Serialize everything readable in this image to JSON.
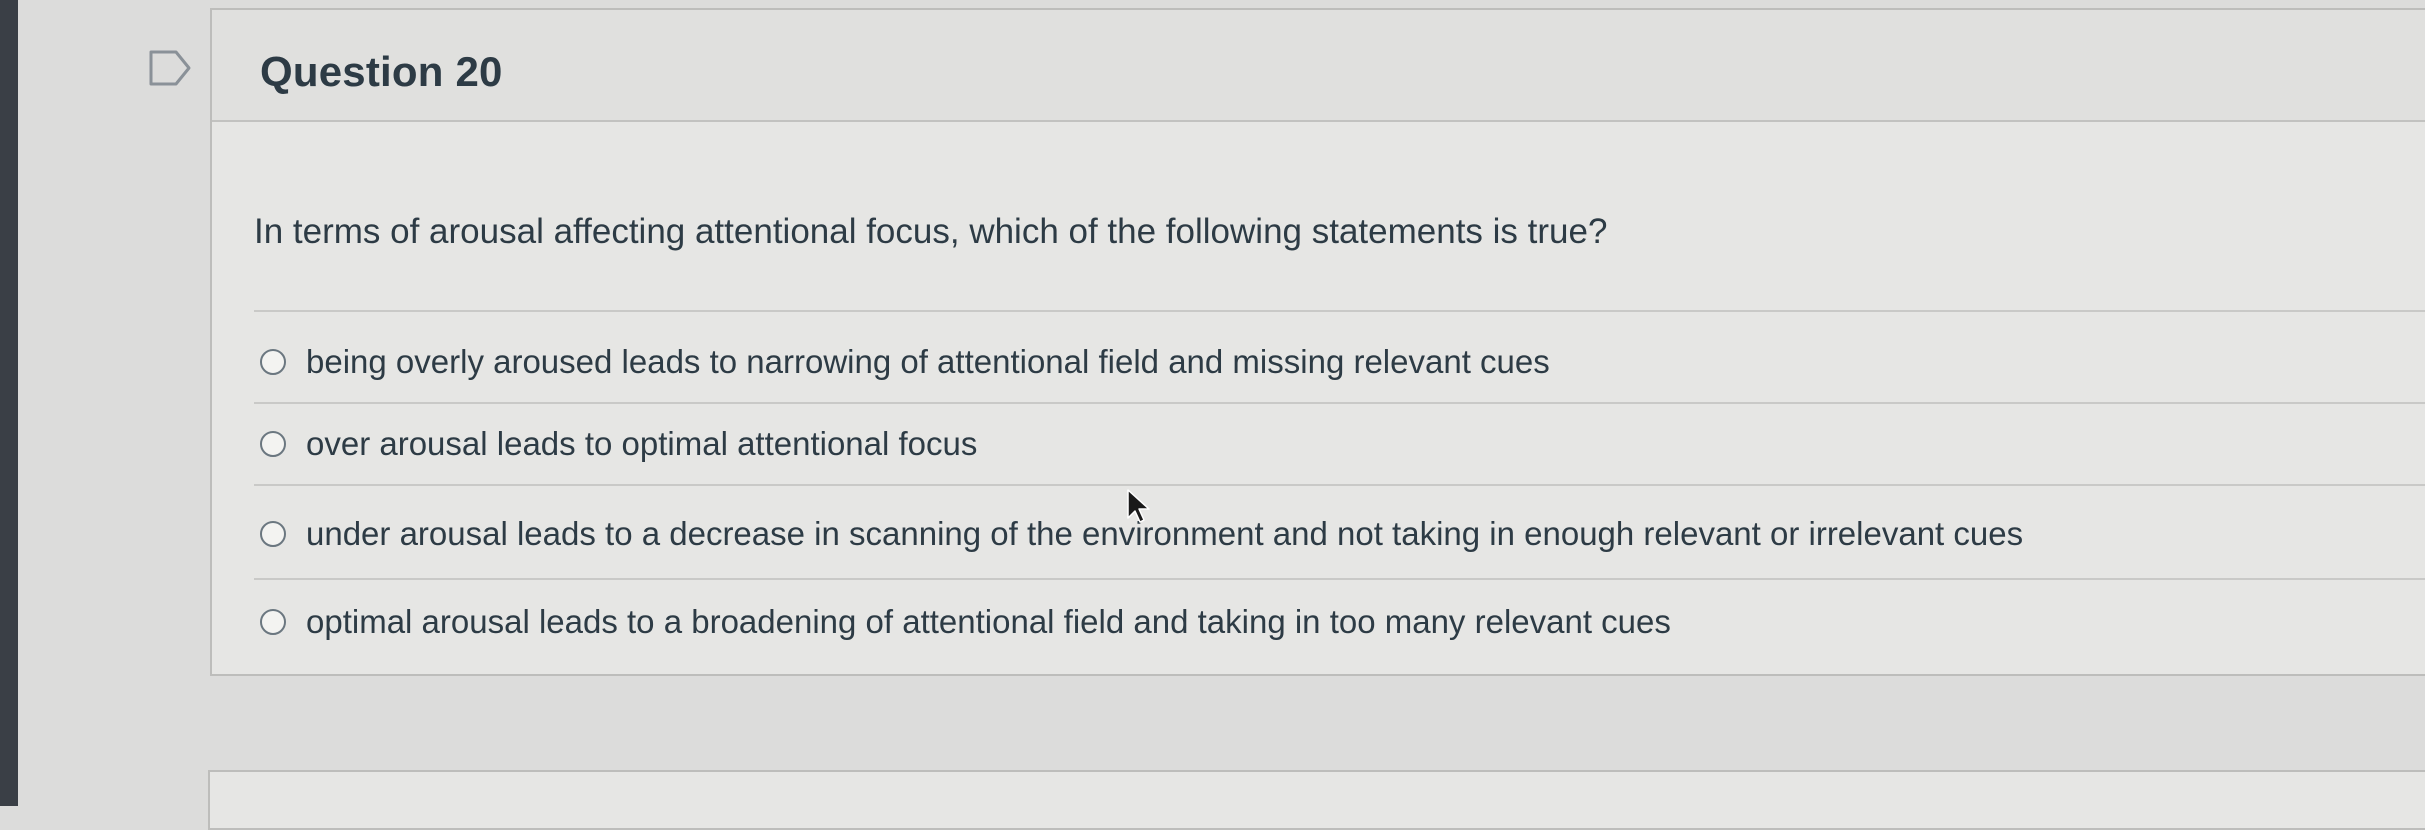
{
  "question": {
    "title": "Question 20",
    "text": "In terms of arousal affecting attentional focus, which of the following statements is true?",
    "answers": [
      {
        "label": "being overly aroused leads to narrowing of attentional field and missing relevant cues"
      },
      {
        "label": "over arousal leads to optimal attentional focus"
      },
      {
        "label": "under arousal leads to a decrease in scanning of the environment and not taking in enough relevant or irrelevant cues"
      },
      {
        "label": "optimal arousal leads to a broadening of attentional field and taking in too many relevant cues"
      }
    ],
    "flag_icon": "flag-question-icon"
  },
  "colors": {
    "text": "#2d3b45",
    "background": "#dcdcdb",
    "card": "#e6e6e4"
  }
}
